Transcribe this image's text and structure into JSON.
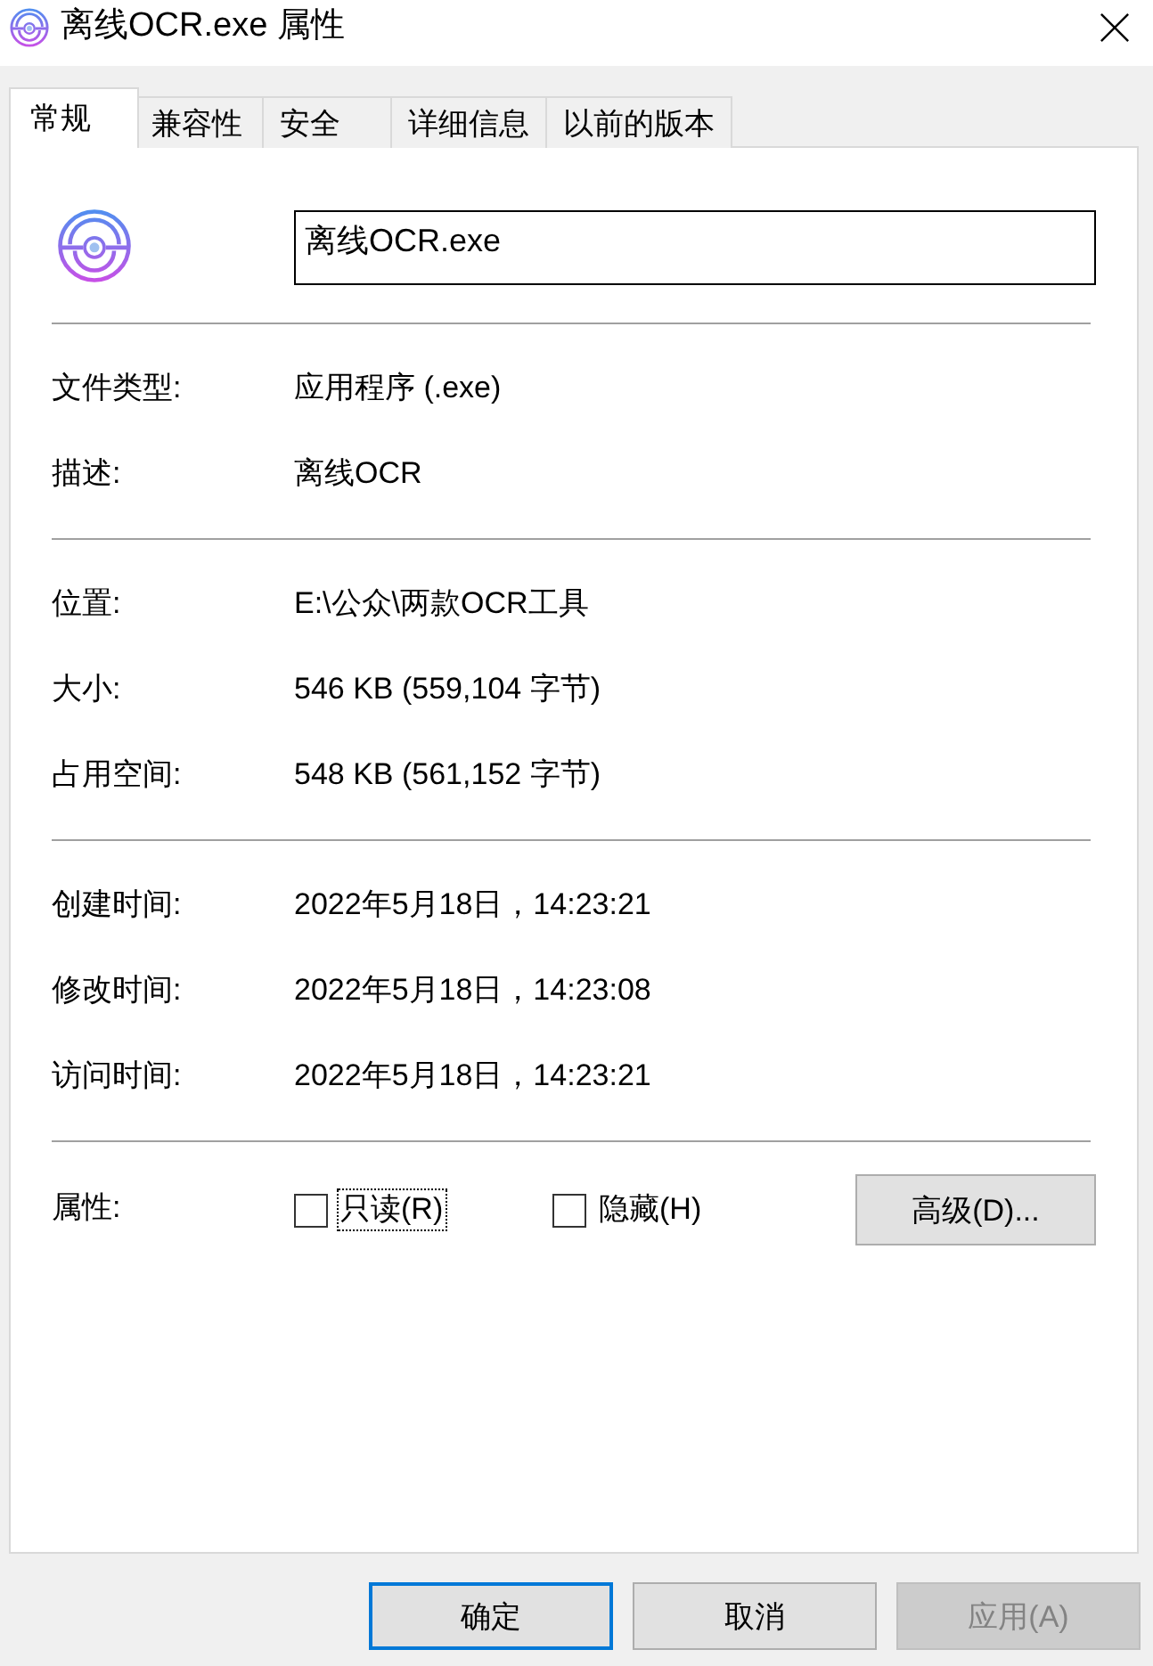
{
  "window": {
    "title": "离线OCR.exe 属性"
  },
  "tabs": [
    {
      "label": "常规",
      "selected": true
    },
    {
      "label": "兼容性",
      "selected": false
    },
    {
      "label": "安全",
      "selected": false
    },
    {
      "label": "详细信息",
      "selected": false
    },
    {
      "label": "以前的版本",
      "selected": false
    }
  ],
  "file": {
    "name": "离线OCR.exe"
  },
  "sections": [
    {
      "rows": [
        {
          "label": "文件类型:",
          "value": "应用程序 (.exe)"
        },
        {
          "label": "描述:",
          "value": "离线OCR"
        }
      ]
    },
    {
      "rows": [
        {
          "label": "位置:",
          "value": "E:\\公众\\两款OCR工具"
        },
        {
          "label": "大小:",
          "value": "546 KB (559,104 字节)"
        },
        {
          "label": "占用空间:",
          "value": "548 KB (561,152 字节)"
        }
      ]
    },
    {
      "rows": [
        {
          "label": "创建时间:",
          "value": "2022年5月18日，14:23:21"
        },
        {
          "label": "修改时间:",
          "value": "2022年5月18日，14:23:08"
        },
        {
          "label": "访问时间:",
          "value": "2022年5月18日，14:23:21"
        }
      ]
    }
  ],
  "attributes": {
    "label": "属性:",
    "options": [
      {
        "label": "只读(R)",
        "checked": false,
        "focused": true
      },
      {
        "label": "隐藏(H)",
        "checked": false,
        "focused": false
      }
    ],
    "advanced_button": "高级(D)..."
  },
  "buttons": [
    {
      "label": "确定",
      "default": true,
      "disabled": false
    },
    {
      "label": "取消",
      "default": false,
      "disabled": false
    },
    {
      "label": "应用(A)",
      "default": false,
      "disabled": true
    }
  ]
}
